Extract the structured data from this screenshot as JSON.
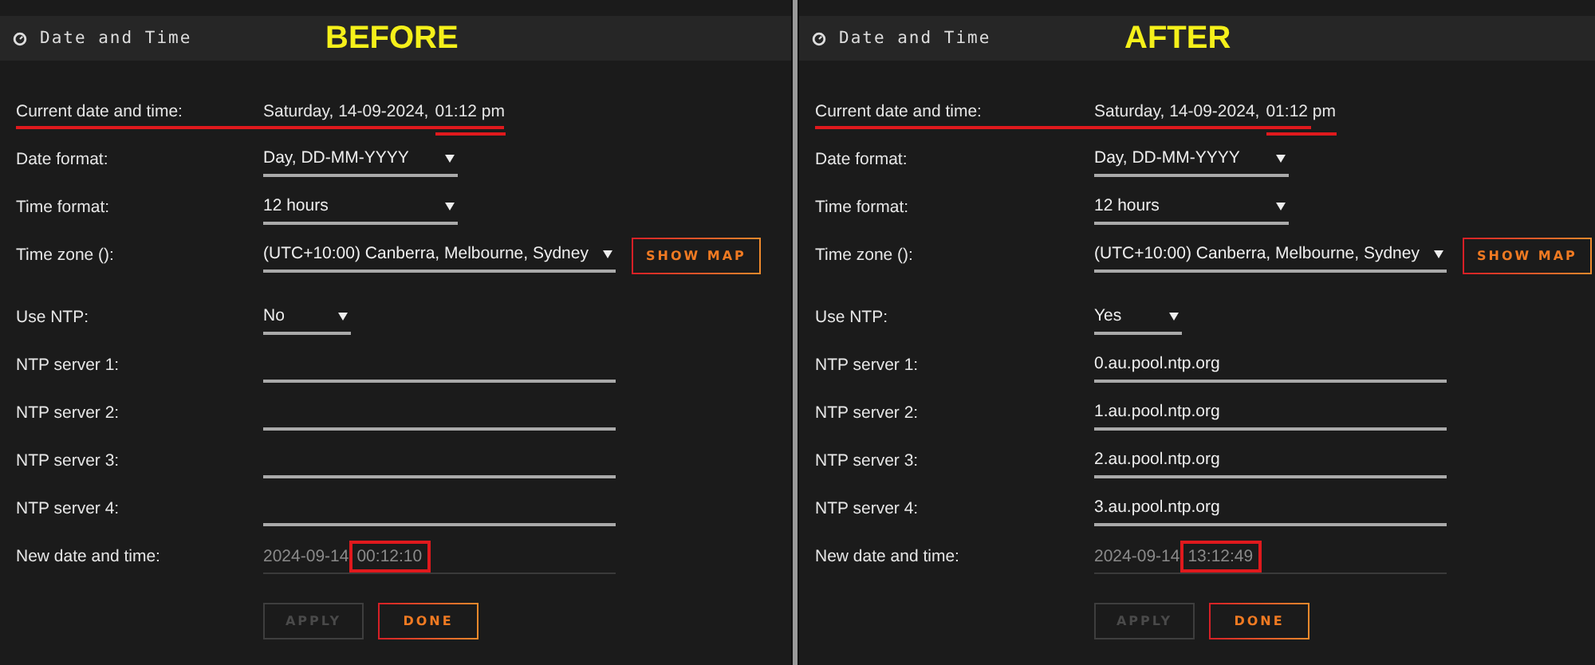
{
  "panels": [
    {
      "caption": "BEFORE",
      "title": "Date and Time",
      "current": {
        "label": "Current date and time:",
        "date": "Saturday, 14-09-2024,",
        "time": "01:12 pm",
        "annotated": true
      },
      "fields": [
        {
          "kind": "select",
          "label": "Date format:",
          "value": "Day, DD-MM-YYYY"
        },
        {
          "kind": "select",
          "label": "Time format:",
          "value": "12 hours"
        },
        {
          "kind": "select",
          "label": "Time zone ():",
          "value": "(UTC+10:00) Canberra, Melbourne, Sydney",
          "button": "SHOW MAP"
        },
        {
          "kind": "select",
          "label": "Use NTP:",
          "value": "No"
        },
        {
          "kind": "text",
          "label": "NTP server 1:"
        },
        {
          "kind": "text",
          "label": "NTP server 2:"
        },
        {
          "kind": "text",
          "label": "NTP server 3:"
        },
        {
          "kind": "text",
          "label": "NTP server 4:"
        }
      ],
      "new_datetime": {
        "label": "New date and time:",
        "date": "2024-09-14",
        "time": "00:12:10",
        "highlighted": true
      },
      "buttons": [
        {
          "label": "APPLY",
          "disabled": true
        },
        {
          "label": "DONE",
          "disabled": false
        }
      ]
    },
    {
      "caption": "AFTER",
      "title": "Date and Time",
      "current": {
        "label": "Current date and time:",
        "date": "Saturday, 14-09-2024,",
        "time": "01:12 pm",
        "annotated": true
      },
      "fields": [
        {
          "kind": "select",
          "label": "Date format:",
          "value": "Day, DD-MM-YYYY"
        },
        {
          "kind": "select",
          "label": "Time format:",
          "value": "12 hours"
        },
        {
          "kind": "select",
          "label": "Time zone ():",
          "value": "(UTC+10:00) Canberra, Melbourne, Sydney",
          "button": "SHOW MAP"
        },
        {
          "kind": "select",
          "label": "Use NTP:",
          "value": "Yes"
        },
        {
          "kind": "text",
          "label": "NTP server 1:",
          "value": "0.au.pool.ntp.org"
        },
        {
          "kind": "text",
          "label": "NTP server 2:",
          "value": "1.au.pool.ntp.org"
        },
        {
          "kind": "text",
          "label": "NTP server 3:",
          "value": "2.au.pool.ntp.org"
        },
        {
          "kind": "text",
          "label": "NTP server 4:",
          "value": "3.au.pool.ntp.org"
        }
      ],
      "new_datetime": {
        "label": "New date and time:",
        "date": "2024-09-14",
        "time": "13:12:49",
        "highlighted": true
      },
      "buttons": [
        {
          "label": "APPLY",
          "disabled": true
        },
        {
          "label": "DONE",
          "disabled": false
        }
      ]
    }
  ]
}
